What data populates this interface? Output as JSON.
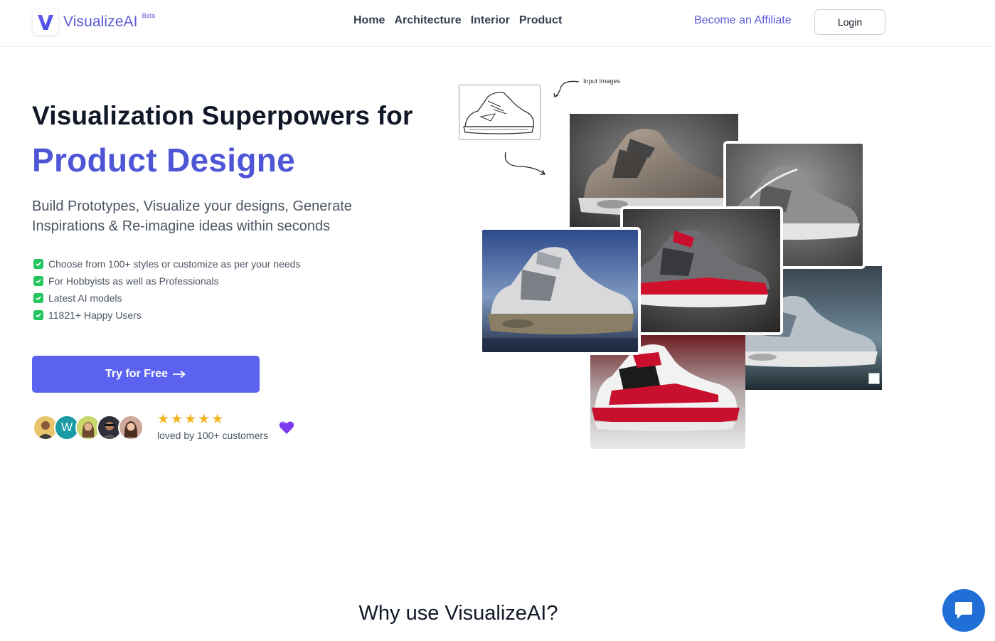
{
  "header": {
    "brand": "VisualizeAI",
    "beta": "Beta",
    "nav": [
      {
        "label": "Home"
      },
      {
        "label": "Architecture"
      },
      {
        "label": "Interior"
      },
      {
        "label": "Product"
      }
    ],
    "affiliate": "Become an Affiliate",
    "login": "Login"
  },
  "hero": {
    "title_line1": "Visualization Superpowers for",
    "title_line2": "Product Designe",
    "subtitle": "Build Prototypes, Visualize your designs, Generate Inspirations & Re-imagine ideas within seconds",
    "features": [
      "Choose from 100+ styles or customize as per your needs",
      "For Hobbyists as well as Professionals",
      "Latest AI models",
      "11821+ Happy Users"
    ],
    "cta": "Try for Free",
    "cta_icon": "arrow-right-icon",
    "avatar_letter": "W",
    "rating": 5,
    "loved_text": "loved by 100+ customers",
    "heart_icon": "purple-heart-icon"
  },
  "collage": {
    "input_label": "Input Images"
  },
  "section": {
    "why_title": "Why use VisualizeAI?"
  },
  "colors": {
    "brand": "#5b5bd6",
    "accent_title": "#4f56d6",
    "cta": "#5b62f0",
    "check": "#22c55e",
    "star": "#f5b324",
    "chat": "#1f6fd6"
  }
}
